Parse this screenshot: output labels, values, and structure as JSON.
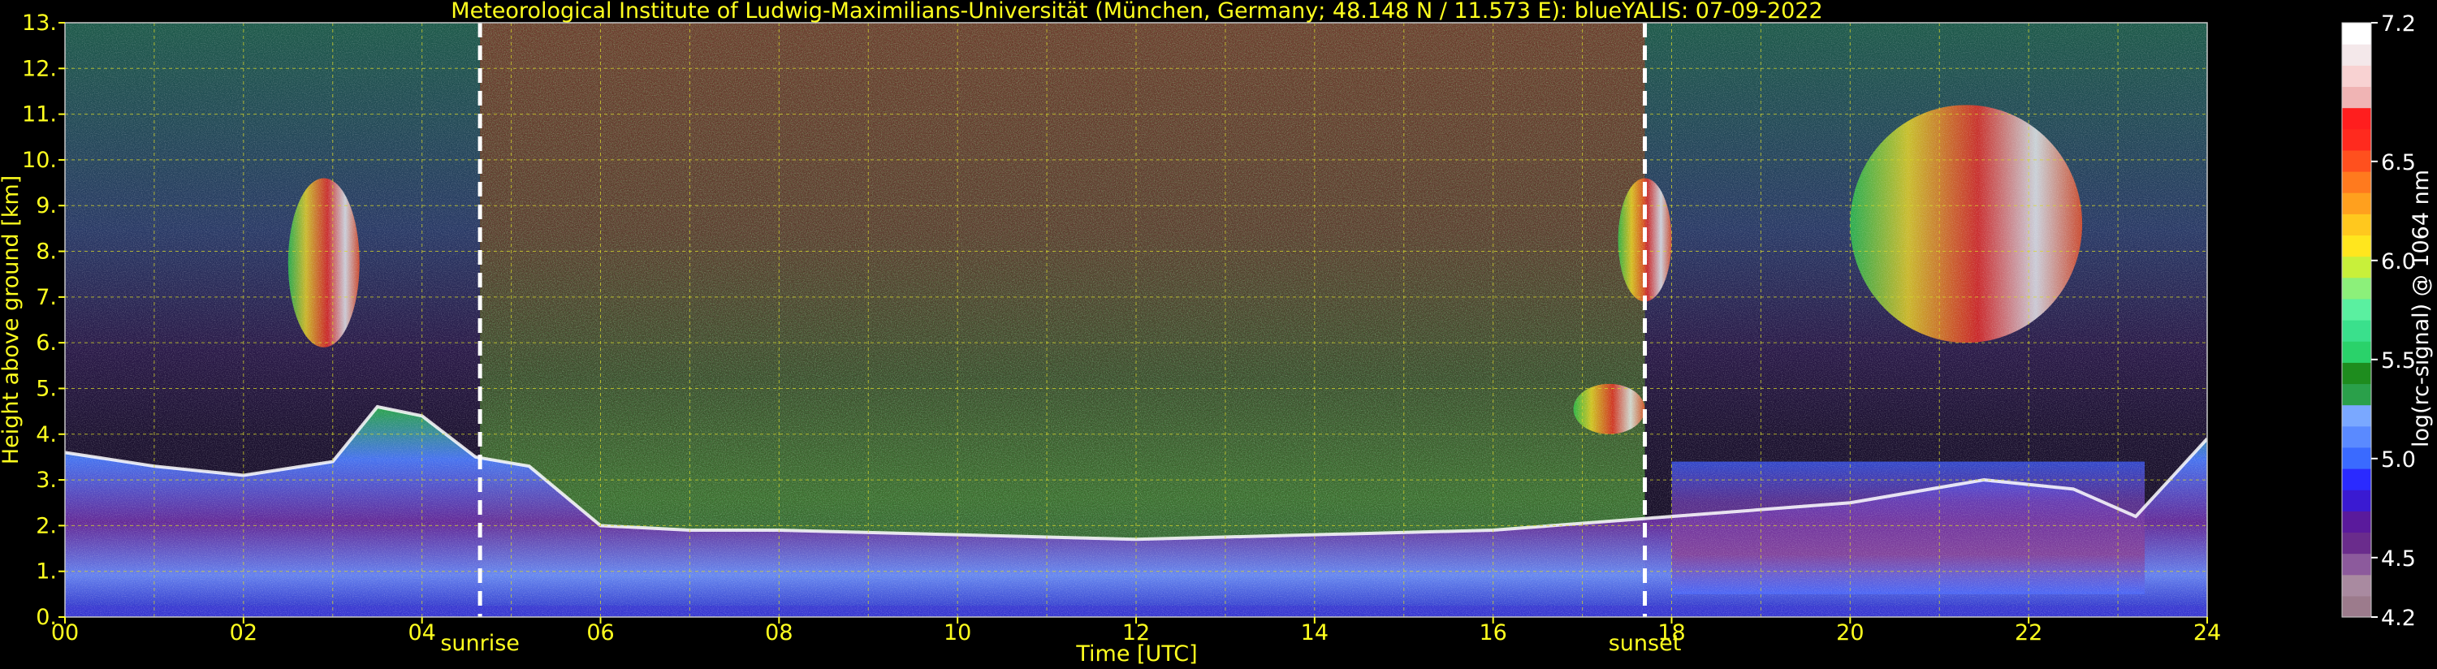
{
  "chart_data": {
    "type": "heatmap",
    "title": "Meteorological Institute of Ludwig-Maximilians-Universität (München, Germany; 48.148 N / 11.573 E):     blueYALIS: 07-09-2022",
    "xlabel": "Time [UTC]",
    "ylabel": "Height above ground [km]",
    "colorbar_label": "log(rc-signal) @ 1064 nm",
    "xlim": [
      0,
      24
    ],
    "ylim": [
      0,
      13
    ],
    "x_ticks": [
      "00",
      "02",
      "04",
      "06",
      "08",
      "10",
      "12",
      "14",
      "16",
      "18",
      "20",
      "22",
      "24"
    ],
    "y_ticks": [
      "0.",
      "1.",
      "2.",
      "3.",
      "4.",
      "5.",
      "6.",
      "7.",
      "8.",
      "9.",
      "10.",
      "11.",
      "12.",
      "13."
    ],
    "grid": true,
    "colorbar": {
      "range": [
        4.2,
        7.2
      ],
      "ticks": [
        "4.2",
        "4.5",
        "5.0",
        "5.5",
        "6.0",
        "6.5",
        "7.2"
      ],
      "tick_values": [
        4.2,
        4.5,
        5.0,
        5.5,
        6.0,
        6.5,
        7.2
      ],
      "colors": [
        "#9c7b8c",
        "#a98aa0",
        "#8c5a9c",
        "#6a2c8c",
        "#5a1a9c",
        "#3a1ad2",
        "#2a2aff",
        "#3a6aff",
        "#5a8aff",
        "#7aa8ff",
        "#2aa04a",
        "#1e8c1e",
        "#2ad26a",
        "#3ae08c",
        "#5af0a0",
        "#8cf07a",
        "#c8f03a",
        "#ffe61e",
        "#ffc81e",
        "#ffa01e",
        "#ff7a1e",
        "#ff501e",
        "#ff2a1e",
        "#ff1e1e",
        "#f0b4b4",
        "#f8d2d2",
        "#f4e8ea",
        "#ffffff"
      ]
    },
    "annotations": [
      {
        "text": "sunrise",
        "x": 4.65
      },
      {
        "text": "sunset",
        "x": 17.7
      }
    ],
    "features": [
      {
        "kind": "boundary_layer_top",
        "points": [
          [
            0,
            3.6
          ],
          [
            1,
            3.3
          ],
          [
            2,
            3.1
          ],
          [
            3,
            3.4
          ],
          [
            3.5,
            4.6
          ],
          [
            4,
            4.4
          ],
          [
            4.6,
            3.5
          ],
          [
            5.2,
            3.3
          ],
          [
            6,
            2.0
          ],
          [
            7,
            1.9
          ],
          [
            8,
            1.9
          ],
          [
            10,
            1.8
          ],
          [
            12,
            1.7
          ],
          [
            14,
            1.8
          ],
          [
            16,
            1.9
          ],
          [
            18,
            2.2
          ],
          [
            20,
            2.5
          ],
          [
            21.5,
            3.0
          ],
          [
            22.5,
            2.8
          ],
          [
            23.2,
            2.2
          ],
          [
            24,
            3.9
          ]
        ]
      },
      {
        "kind": "cirrus",
        "x_range": [
          20.0,
          22.6
        ],
        "y_range": [
          6.0,
          11.2
        ]
      },
      {
        "kind": "cirrus",
        "x_range": [
          2.5,
          3.3
        ],
        "y_range": [
          5.9,
          9.6
        ]
      },
      {
        "kind": "cirrus",
        "x_range": [
          17.4,
          18.0
        ],
        "y_range": [
          6.9,
          9.6
        ]
      },
      {
        "kind": "mid_level_cloud",
        "x_range": [
          16.9,
          17.7
        ],
        "y_range": [
          4.0,
          5.1
        ]
      }
    ]
  }
}
